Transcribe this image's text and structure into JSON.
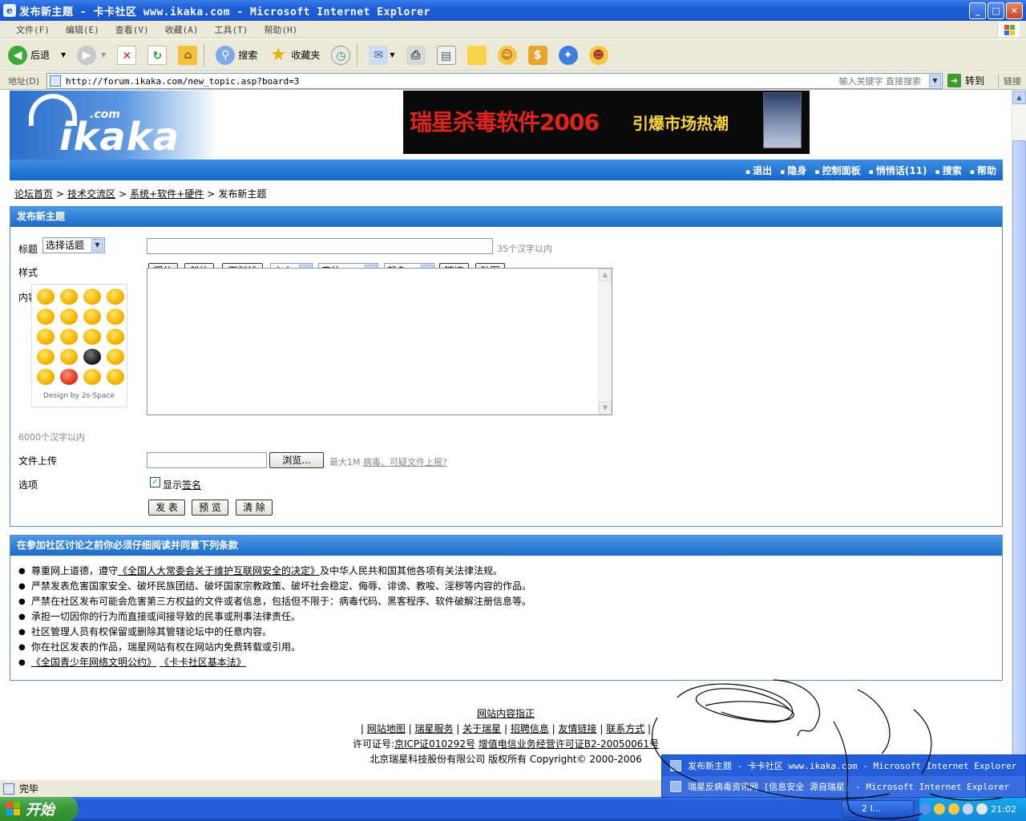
{
  "window": {
    "title": "发布新主题 - 卡卡社区 www.ikaka.com - Microsoft Internet Explorer",
    "controls": [
      "_",
      "□",
      "✕"
    ]
  },
  "menu": [
    "文件(F)",
    "编辑(E)",
    "查看(V)",
    "收藏(A)",
    "工具(T)",
    "帮助(H)"
  ],
  "toolbar": {
    "back": "后退",
    "search": "搜索",
    "favorites": "收藏夹"
  },
  "address": {
    "label": "地址(D)",
    "url": "http://forum.ikaka.com/new_topic.asp?board=3",
    "search_hint": "输入关键字  直接搜索",
    "go": "转到",
    "links": "链接"
  },
  "header": {
    "logo": "ikaka",
    "logo_com": ".com",
    "banner_main": "瑞星杀毒软件2006",
    "banner_sub": "引爆市场热潮"
  },
  "nav": [
    "退出",
    "隐身",
    "控制面板",
    "悄悄话(11)",
    "搜索",
    "帮助"
  ],
  "breadcrumb": {
    "items": [
      "论坛首页",
      "技术交流区",
      "系统+软件+硬件"
    ],
    "current": "发布新主题",
    "sep": ">"
  },
  "post_form": {
    "header": "发布新主题",
    "title_label": "标题",
    "topic_select": "选择话题",
    "title_hint": "35个汉字以内",
    "style_label": "样式",
    "bold": "粗体",
    "italic": "斜体",
    "underline": "下划线",
    "size": "大小",
    "font": "字体",
    "color": "颜色",
    "link": "链接",
    "image": "贴图",
    "content_label": "内容",
    "emoticon_credit": "Design by 2s-Space",
    "content_hint": "6000个汉字以内",
    "upload_label": "文件上传",
    "browse": "浏览...",
    "upload_hint": "最大1M",
    "upload_link": "病毒、可疑文件上报?",
    "options_label": "选项",
    "show_sig_prefix": "显示",
    "show_sig_link": "签名",
    "show_sig_checked": true,
    "submit": "发 表",
    "preview": "预 览",
    "clear": "清 除"
  },
  "terms": {
    "header": "在参加社区讨论之前你必须仔细阅读并同意下列条款",
    "items": [
      {
        "pre": "尊重网上道德，遵守",
        "link": "《全国人大常委会关于维护互联网安全的决定》",
        "post": "及中华人民共和国其他各项有关法律法规。"
      },
      {
        "pre": "严禁发表危害国家安全、破坏民族团结、破坏国家宗教政策、破坏社会稳定、侮辱、诽谤、教唆、淫秽等内容的作品。",
        "link": "",
        "post": ""
      },
      {
        "pre": "严禁在社区发布可能会危害第三方权益的文件或者信息，包括但不限于：病毒代码、黑客程序、软件破解注册信息等。",
        "link": "",
        "post": ""
      },
      {
        "pre": "承担一切因你的行为而直接或间接导致的民事或刑事法律责任。",
        "link": "",
        "post": ""
      },
      {
        "pre": "社区管理人员有权保留或删除其管辖论坛中的任意内容。",
        "link": "",
        "post": ""
      },
      {
        "pre": "你在社区发表的作品，瑞星网站有权在网站内免费转载或引用。",
        "link": "",
        "post": ""
      }
    ],
    "last_links": [
      "《全国青少年网络文明公约》",
      "《卡卡社区基本法》"
    ]
  },
  "footer": {
    "top_link": "网站内容指正",
    "links": [
      "网站地图",
      "瑞星服务",
      "关于瑞星",
      "招聘信息",
      "友情链接",
      "联系方式"
    ],
    "license_prefix": "许可证号:",
    "icp": "京ICP证010292号",
    "telecom": "增值电信业务经营许可证B2-20050061号",
    "copyright": "北京瑞星科技股份有限公司   版权所有 Copyright© 2000-2006"
  },
  "statusbar": {
    "text": "完毕"
  },
  "taskbar": {
    "start": "开始",
    "group_label": "2 I...",
    "clock": "21:02",
    "popup_items": [
      "发布新主题 - 卡卡社区 www.ikaka.com - Microsoft Internet Explorer",
      "瑞星反病毒资讯网 [信息安全 源自瑞星] - Microsoft Internet Explorer"
    ]
  },
  "colors": {
    "xp_blue": "#245edc",
    "forum_header": "#1d6ac9",
    "banner_red": "#e2231a",
    "banner_yellow": "#f8d33a"
  }
}
